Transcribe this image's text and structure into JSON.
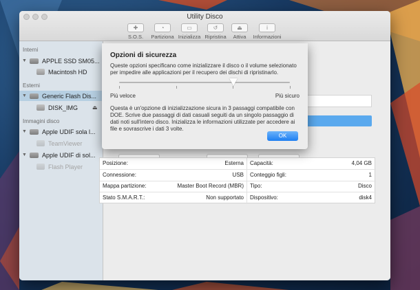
{
  "window": {
    "title": "Utility Disco"
  },
  "toolbar": {
    "items": [
      {
        "label": "S.O.S.",
        "icon": "stethoscope-icon"
      },
      {
        "label": "Partiziona",
        "icon": "pie-chart-icon"
      },
      {
        "label": "Inizializza",
        "icon": "erase-icon"
      },
      {
        "label": "Ripristina",
        "icon": "restore-icon"
      },
      {
        "label": "Attiva",
        "icon": "mount-icon"
      },
      {
        "label": "Informazioni",
        "icon": "info-icon"
      }
    ]
  },
  "sidebar": {
    "sections": [
      {
        "label": "Interni"
      },
      {
        "label": "Esterni"
      },
      {
        "label": "Immagini disco"
      }
    ],
    "items": [
      {
        "label": "APPLE SSD SM05...",
        "kind": "disk",
        "disclosure": "▼"
      },
      {
        "label": "Macintosh HD",
        "kind": "volume"
      },
      {
        "label": "Generic Flash Dis...",
        "kind": "disk",
        "disclosure": "▼",
        "selected": true
      },
      {
        "label": "DISK_IMG",
        "kind": "volume",
        "eject": "⏏"
      },
      {
        "label": "Apple UDIF sola l...",
        "kind": "disk",
        "disclosure": "▼"
      },
      {
        "label": "TeamViewer",
        "kind": "volume",
        "dimmed": true
      },
      {
        "label": "Apple UDIF di sol...",
        "kind": "disk",
        "disclosure": "▼"
      },
      {
        "label": "Flash Player",
        "kind": "volume",
        "dimmed": true
      }
    ]
  },
  "sheet": {
    "title": "Opzioni di sicurezza",
    "description": "Queste opzioni specificano come inizializzare il disco o il volume selezionato per impedire alle applicazioni per il recupero dei dischi di ripristinarlo.",
    "slider": {
      "min_label": "Più veloce",
      "max_label": "Più sicuro",
      "level": 0.67,
      "ticks": 4
    },
    "body": "Questa è un'opzione di inizializzazione sicura in 3 passaggi compatibile con DOE. Scrive due passaggi di dati casuali seguiti da un singolo passaggio di dati noti sull'intero disco. Inizializza le informazioni utilizzate per accedere ai file e sovrascrive i dati 3 volte.",
    "ok_label": "OK"
  },
  "info": {
    "rows": [
      {
        "left_label": "Posizione:",
        "left_value": "Esterna",
        "right_label": "Capacità:",
        "right_value": "4,04 GB"
      },
      {
        "left_label": "Connessione:",
        "left_value": "USB",
        "right_label": "Conteggio figli:",
        "right_value": "1"
      },
      {
        "left_label": "Mappa partizione:",
        "left_value": "Master Boot Record (MBR)",
        "right_label": "Tipo:",
        "right_value": "Disco"
      },
      {
        "left_label": "Stato S.M.A.R.T.:",
        "left_value": "Non supportato",
        "right_label": "Dispositivo:",
        "right_value": "disk4"
      }
    ]
  },
  "colors": {
    "accent": "#1d7ef2",
    "selection": "#b6cfe2",
    "sidebar": "#dbe3ea"
  }
}
